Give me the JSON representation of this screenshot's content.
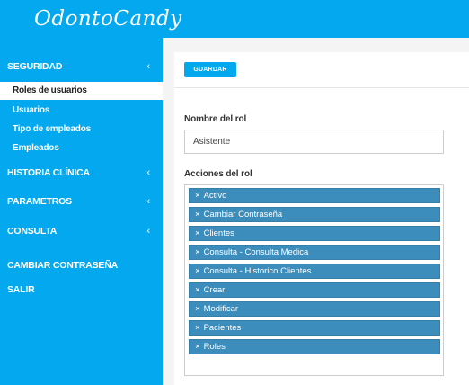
{
  "app": {
    "logo_text": "OdontoCandy"
  },
  "sidebar": {
    "sections": [
      {
        "label": "SEGURIDAD",
        "chevron": "‹"
      },
      {
        "label": "HISTORIA CLÍNICA",
        "chevron": "‹"
      },
      {
        "label": "PARAMETROS",
        "chevron": "‹"
      },
      {
        "label": "CONSULTA",
        "chevron": "‹"
      },
      {
        "label": "CAMBIAR CONTRASEÑA"
      },
      {
        "label": "SALIR"
      }
    ],
    "seguridad_items": [
      {
        "label": "Roles de usuarios",
        "active": true
      },
      {
        "label": "Usuarios"
      },
      {
        "label": "Tipo de empleados"
      },
      {
        "label": "Empleados"
      }
    ]
  },
  "form": {
    "save_label": "GUARDAR",
    "role_name_label": "Nombre del rol",
    "role_name_value": "Asistente",
    "actions_label": "Acciones del rol",
    "tag_remove_glyph": "×",
    "actions": [
      "Activo",
      "Cambiar Contraseña",
      "Clientes",
      "Consulta - Consulta Medica",
      "Consulta - Historico Clientes",
      "Crear",
      "Modificar",
      "Pacientes",
      "Roles"
    ]
  },
  "colors": {
    "primary": "#04a8ef",
    "tag": "#3c8dbc",
    "active_item_bg": "#ffffff"
  }
}
